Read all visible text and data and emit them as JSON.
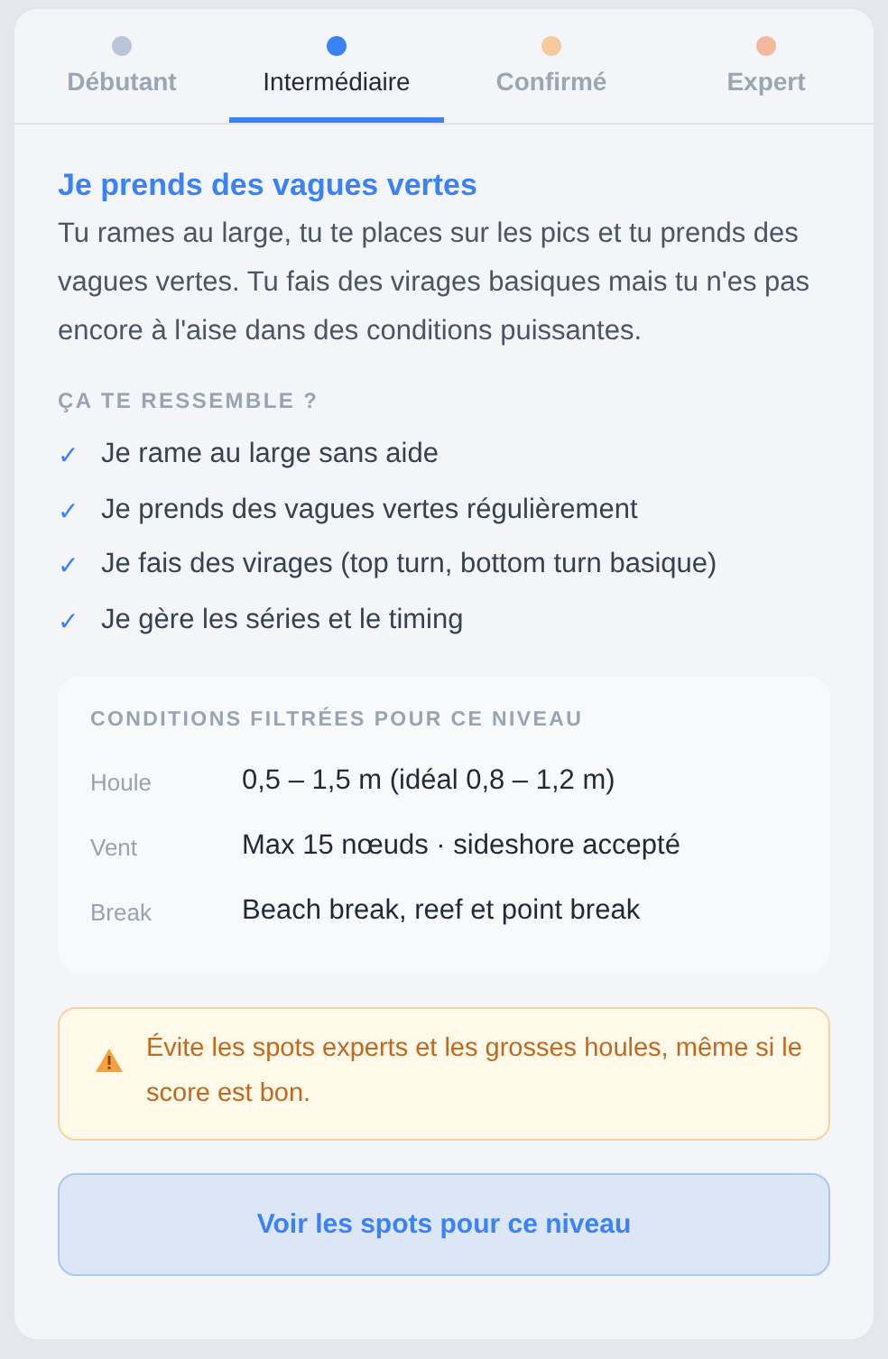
{
  "tabs": [
    {
      "label": "Débutant",
      "selected": false,
      "color": "#b9c5d8"
    },
    {
      "label": "Intermédiaire",
      "selected": true,
      "color": "#3b82f6"
    },
    {
      "label": "Confirmé",
      "selected": false,
      "color": "#f5cb9c"
    },
    {
      "label": "Expert",
      "selected": false,
      "color": "#f2b8a0"
    }
  ],
  "level": {
    "title": "Je prends des vagues vertes",
    "description": "Tu rames au large, tu te places sur les pics et tu prends des vagues vertes. Tu fais des virages basiques mais tu n'es pas encore à l'aise dans des conditions puissantes.",
    "checklist_heading": "ÇA TE RESSEMBLE ?",
    "checklist": [
      {
        "mark": "✓",
        "text": "Je rame au large sans aide"
      },
      {
        "mark": "✓",
        "text": "Je prends des vagues vertes régulièrement"
      },
      {
        "mark": "✓",
        "text": "Je fais des virages (top turn, bottom turn basique)"
      },
      {
        "mark": "✓",
        "text": "Je gère les séries et le timing"
      }
    ]
  },
  "conditions": {
    "heading": "CONDITIONS FILTRÉES POUR CE NIVEAU",
    "rows": [
      {
        "label": "Houle",
        "value": "0,5 – 1,5 m (idéal 0,8 – 1,2 m)"
      },
      {
        "label": "Vent",
        "value": "Max 15 nœuds · sideshore accepté"
      },
      {
        "label": "Break",
        "value": "Beach break, reef et point break"
      }
    ]
  },
  "warning": {
    "text": "Évite les spots experts et les grosses houles, même si le score est bon."
  },
  "button": {
    "label": "Voir les spots pour ce niveau"
  }
}
